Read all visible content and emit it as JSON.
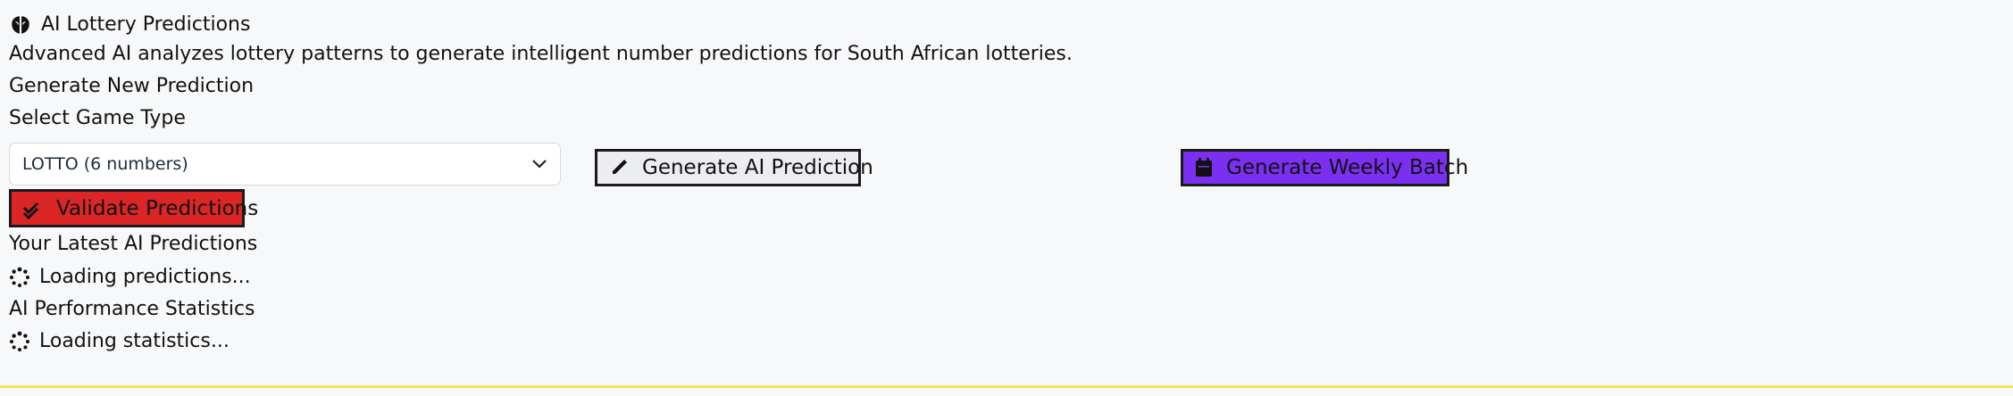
{
  "header": {
    "title": "AI Lottery Predictions",
    "description": "Advanced AI analyzes lottery patterns to generate intelligent number predictions for South African lotteries."
  },
  "generator": {
    "section_title": "Generate New Prediction",
    "select_label": "Select Game Type",
    "select_value": "LOTTO (6 numbers)",
    "buttons": {
      "generate_ai": "Generate AI Prediction",
      "generate_weekly": "Generate Weekly Batch",
      "validate": "Validate Predictions"
    }
  },
  "predictions": {
    "title": "Your Latest AI Predictions",
    "loading": "Loading predictions..."
  },
  "stats": {
    "title": "AI Performance Statistics",
    "loading": "Loading statistics..."
  },
  "colors": {
    "weekly_button": "#7b2ff0",
    "validate_button": "#dc2626",
    "bottom_line": "#f8e35a"
  }
}
